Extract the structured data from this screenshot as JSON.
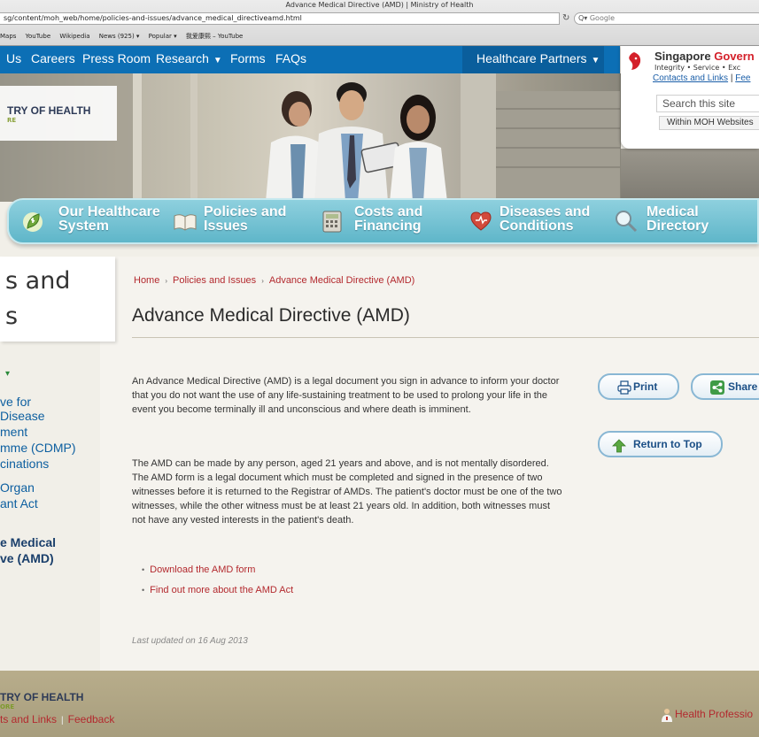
{
  "browser": {
    "window_title": "Advance Medical Directive (AMD) | Ministry of Health",
    "url": "sg/content/moh_web/home/policies-and-issues/advance_medical_directiveamd.html",
    "search_placeholder": "Google",
    "bookmarks": [
      "Maps",
      "YouTube",
      "Wikipedia",
      "News (925) ▾",
      "Popular ▾",
      "我爱康熙 – YouTube"
    ]
  },
  "topnav": {
    "items": [
      {
        "label": "Us"
      },
      {
        "label": "Careers"
      },
      {
        "label": "Press Room"
      },
      {
        "label": "Research"
      },
      {
        "label": "Forms"
      },
      {
        "label": "FAQs"
      }
    ],
    "healthcare_partners": "Healthcare Partners"
  },
  "sggov": {
    "title_1": "Singapore",
    "title_2": "Govern",
    "tagline": "Integrity • Service • Exc",
    "contacts": "Contacts and Links",
    "feedback": "Fee",
    "search_placeholder": "Search this site",
    "scope": "Within MOH Websites"
  },
  "logo": {
    "name": "TRY OF HEALTH",
    "sub": "RE"
  },
  "features": [
    {
      "line1": "Our Healthcare",
      "line2": "System"
    },
    {
      "line1": "Policies and",
      "line2": "Issues"
    },
    {
      "line1": "Costs and",
      "line2": "Financing"
    },
    {
      "line1": "Diseases and",
      "line2": "Conditions"
    },
    {
      "line1": "Medical",
      "line2": "Directory"
    }
  ],
  "sidebar": {
    "title_1": "s and",
    "title_2": "s",
    "items": [
      {
        "label": "ve for"
      },
      {
        "label": "Disease"
      },
      {
        "label": "ment"
      },
      {
        "label": "mme (CDMP)"
      },
      {
        "label": "cinations"
      },
      {
        "label": "Organ"
      },
      {
        "label": "ant Act"
      },
      {
        "label": "e Medical"
      },
      {
        "label": "ve (AMD)"
      }
    ]
  },
  "breadcrumb": [
    "Home",
    "Policies and Issues",
    "Advance Medical Directive (AMD)"
  ],
  "page_title": "Advance Medical Directive (AMD)",
  "paragraphs": [
    "An Advance Medical Directive (AMD) is a legal document you sign in advance to inform your doctor that you do not want the use of any life-sustaining treatment to be used to prolong your life in the event you become terminally ill and unconscious and where death is imminent.",
    "The AMD can be made by any person, aged 21 years and above, and is not mentally disordered. The AMD form is a legal document which must be completed and signed in the presence of two witnesses before it is returned to the Registrar of AMDs. The patient's doctor must be one of the two witnesses, while the other witness must be at least 21 years old. In addition, both witnesses must not have any vested interests in the patient's death."
  ],
  "links": [
    "Download the AMD form",
    "Find out more about the AMD Act"
  ],
  "last_updated": "Last updated on 16 Aug 2013",
  "buttons": {
    "print": "Print",
    "share": "Share",
    "top": "Return to Top"
  },
  "footer": {
    "logo": "TRY OF HEALTH",
    "logo_sub": "ORE",
    "contacts": "ts and Links",
    "feedback": "Feedback",
    "health_prof": "Health Professio"
  },
  "colors": {
    "nav_blue": "#0c6fb5",
    "link_red": "#b3292e",
    "feature_teal": "#5fb6c9"
  }
}
